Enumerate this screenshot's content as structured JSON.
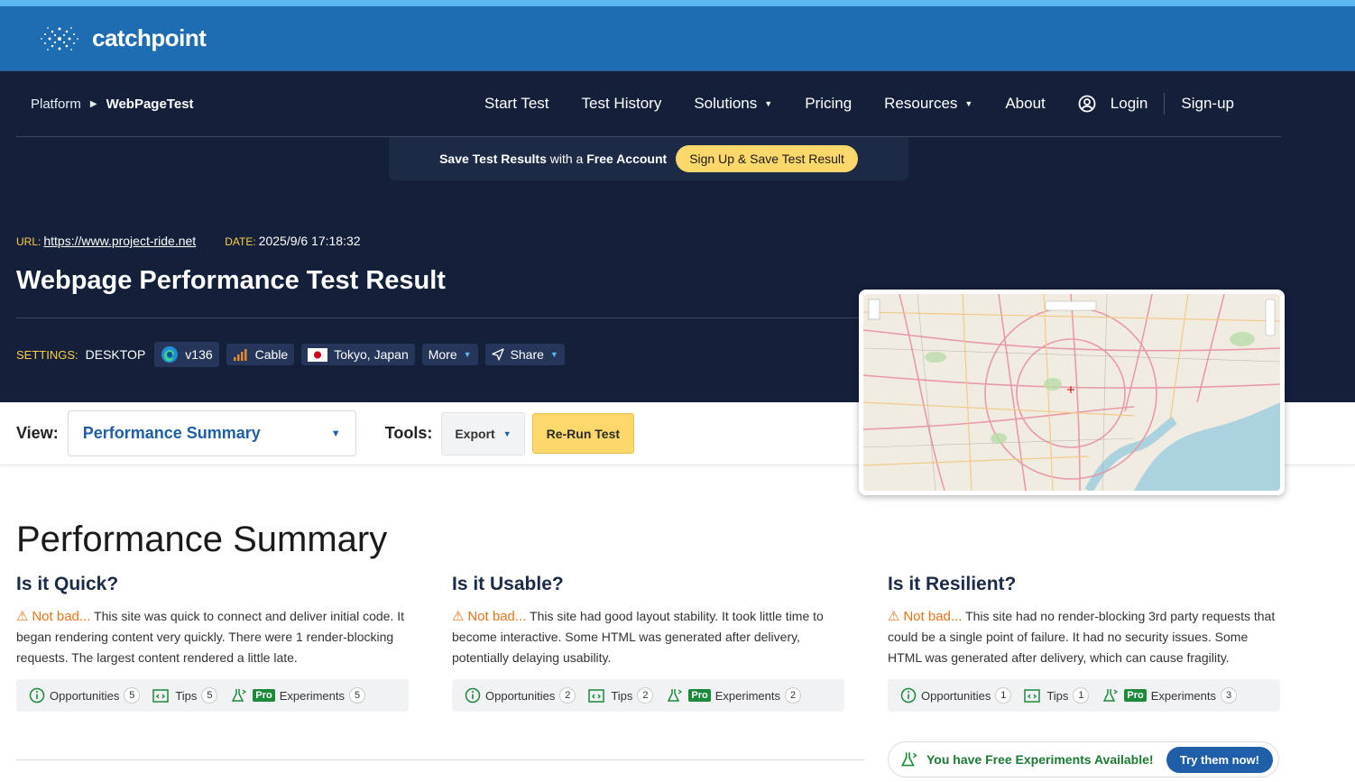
{
  "brand": {
    "name": "catchpoint"
  },
  "nav": {
    "breadcrumb": [
      "Platform",
      "WebPageTest"
    ],
    "items": [
      "Start Test",
      "Test History",
      "Solutions",
      "Pricing",
      "Resources",
      "About"
    ],
    "login": "Login",
    "signup": "Sign-up"
  },
  "promo": {
    "text_1": "Save Test Results",
    "text_2": "with a",
    "text_3": "Free Account",
    "button": "Sign Up & Save Test Result"
  },
  "test": {
    "url_label": "URL:",
    "url": "https://www.project-ride.net",
    "date_label": "DATE:",
    "date": "2025/9/6 17:18:32",
    "title": "Webpage Performance Test Result",
    "settings_label": "SETTINGS:",
    "device": "DESKTOP",
    "browser": "v136",
    "connection": "Cable",
    "location": "Tokyo, Japan",
    "more": "More",
    "share": "Share"
  },
  "toolbar": {
    "view_label": "View:",
    "view_value": "Performance Summary",
    "tools_label": "Tools:",
    "export": "Export",
    "rerun": "Re-Run Test"
  },
  "summary": {
    "title": "Performance Summary",
    "columns": [
      {
        "heading": "Is it Quick?",
        "status": "Not bad...",
        "text": "This site was quick to connect and deliver initial code. It began rendering content very quickly. There were 1 render-blocking requests. The largest content rendered a little late.",
        "opportunities": "5",
        "tips": "5",
        "experiments": "5"
      },
      {
        "heading": "Is it Usable?",
        "status": "Not bad...",
        "text": "This site had good layout stability. It took little time to become interactive. Some HTML was generated after delivery, potentially delaying usability.",
        "opportunities": "2",
        "tips": "2",
        "experiments": "2"
      },
      {
        "heading": "Is it Resilient?",
        "status": "Not bad...",
        "text": "This site had no render-blocking 3rd party requests that could be a single point of failure. It had no security issues. Some HTML was generated after delivery, which can cause fragility.",
        "opportunities": "1",
        "tips": "1",
        "experiments": "3"
      }
    ],
    "labels": {
      "opportunities": "Opportunities",
      "tips": "Tips",
      "pro": "Pro",
      "experiments": "Experiments"
    }
  },
  "free_experiments": {
    "text": "You have Free Experiments Available!",
    "button": "Try them now!"
  },
  "colors": {
    "brand_blue": "#1e6db2",
    "dark_navy": "#14203a",
    "accent_yellow": "#ffd86b",
    "warning_orange": "#e2741a",
    "pro_green": "#1c8a3b"
  }
}
